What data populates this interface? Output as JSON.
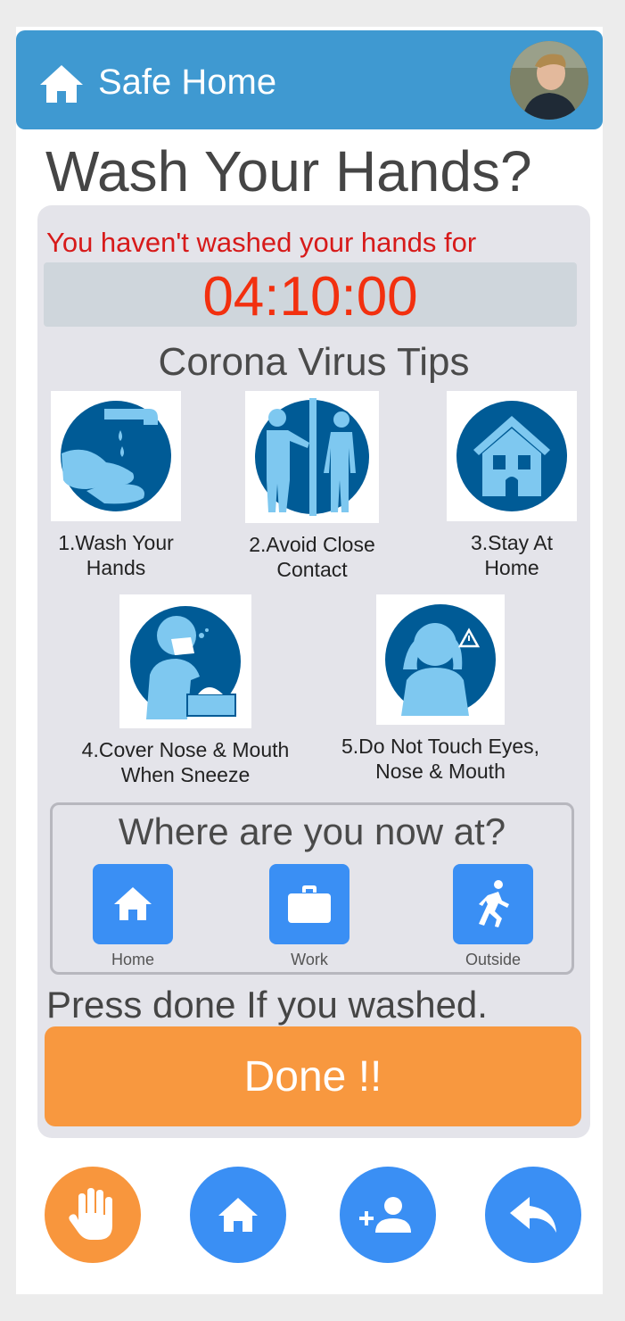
{
  "app": {
    "title": "Safe Home"
  },
  "page": {
    "title": "Wash Your Hands?"
  },
  "status": {
    "message": "You haven't washed your hands for",
    "timer": "04:10:00"
  },
  "tips": {
    "heading": "Corona Virus Tips",
    "items": [
      {
        "line1": "1.Wash Your",
        "line2": "Hands",
        "icon": "wash-hands-icon"
      },
      {
        "line1": "2.Avoid Close",
        "line2": "Contact",
        "icon": "avoid-contact-icon"
      },
      {
        "line1": "3.Stay At",
        "line2": "Home",
        "icon": "stay-home-icon"
      },
      {
        "line1": "4.Cover Nose & Mouth",
        "line2": "When Sneeze",
        "icon": "cover-sneeze-icon"
      },
      {
        "line1": "5.Do Not Touch Eyes,",
        "line2": "Nose & Mouth",
        "icon": "no-touch-face-icon"
      }
    ]
  },
  "location": {
    "question": "Where are you now at?",
    "options": [
      {
        "label": "Home",
        "icon": "home-icon"
      },
      {
        "label": "Work",
        "icon": "briefcase-icon"
      },
      {
        "label": "Outside",
        "icon": "running-person-icon"
      }
    ]
  },
  "action": {
    "prompt": "Press done If you washed.",
    "done_label": "Done !!"
  },
  "bottom_nav": [
    {
      "icon": "hand-icon",
      "color": "#f8963d"
    },
    {
      "icon": "home-icon",
      "color": "#3a8ff4"
    },
    {
      "icon": "add-person-icon",
      "color": "#3a8ff4"
    },
    {
      "icon": "reply-icon",
      "color": "#3a8ff4"
    }
  ],
  "colors": {
    "appbar": "#3f99d1",
    "accent_blue": "#3a8ff4",
    "done_orange": "#f8983f",
    "timer_red": "#f2300f",
    "warning_red": "#d71a1a",
    "icon_dark_blue": "#005b96",
    "icon_light_blue": "#7ec8f0"
  }
}
